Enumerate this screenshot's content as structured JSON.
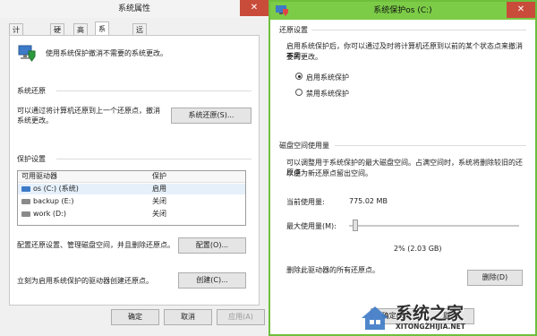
{
  "left": {
    "title": "系统属性",
    "tabs": [
      "计算机名",
      "硬件",
      "高级",
      "系统保护",
      "远程"
    ],
    "intro": "使用系统保护撤消不需要的系统更改。",
    "restore_section_title": "系统还原",
    "restore_desc_line1": "可以通过将计算机还原到上一个还原点，撤消",
    "restore_desc_line2": "系统更改。",
    "restore_button": "系统还原(S)...",
    "protection_section_title": "保护设置",
    "table_headers": [
      "可用驱动器",
      "保护"
    ],
    "drives": [
      {
        "name": "os (C:) (系统)",
        "protection": "启用"
      },
      {
        "name": "backup (E:)",
        "protection": "关闭"
      },
      {
        "name": "work (D:)",
        "protection": "关闭"
      }
    ],
    "config_desc": "配置还原设置、管理磁盘空间，并且删除还原点。",
    "config_button": "配置(O)...",
    "create_desc": "立刻为启用系统保护的驱动器创建还原点。",
    "create_button": "创建(C)...",
    "ok": "确定",
    "cancel": "取消",
    "apply": "应用(A)"
  },
  "right": {
    "title": "系统保护os (C:)",
    "restore_settings_title": "还原设置",
    "restore_desc_line1": "启用系统保护后，你可以通过及时将计算机还原到以前的某个状态点来撤消不需",
    "restore_desc_line2": "要的更改。",
    "radio_on": "启用系统保护",
    "radio_off": "禁用系统保护",
    "disk_title": "磁盘空间使用量",
    "disk_desc_line1": "可以调整用于系统保护的最大磁盘空间。占满空间时，系统将删除较旧的还原点",
    "disk_desc_line2": "以便为新还原点留出空间。",
    "current_usage_label": "当前使用量:",
    "current_usage_value": "775.02 MB",
    "max_usage_label": "最大使用量(M):",
    "max_usage_percent_text": "2% (2.03 GB)",
    "max_usage_fraction": 0.02,
    "delete_desc": "删除此驱动器的所有还原点。",
    "delete_button": "删除(D)",
    "ok": "确定(O)",
    "cancel": "取消"
  },
  "watermark": {
    "brand": "系统之家",
    "url": "XITONGZHIJIA.NET"
  },
  "colors": {
    "accent": "#7ccc47",
    "close": "#c94c3a"
  }
}
